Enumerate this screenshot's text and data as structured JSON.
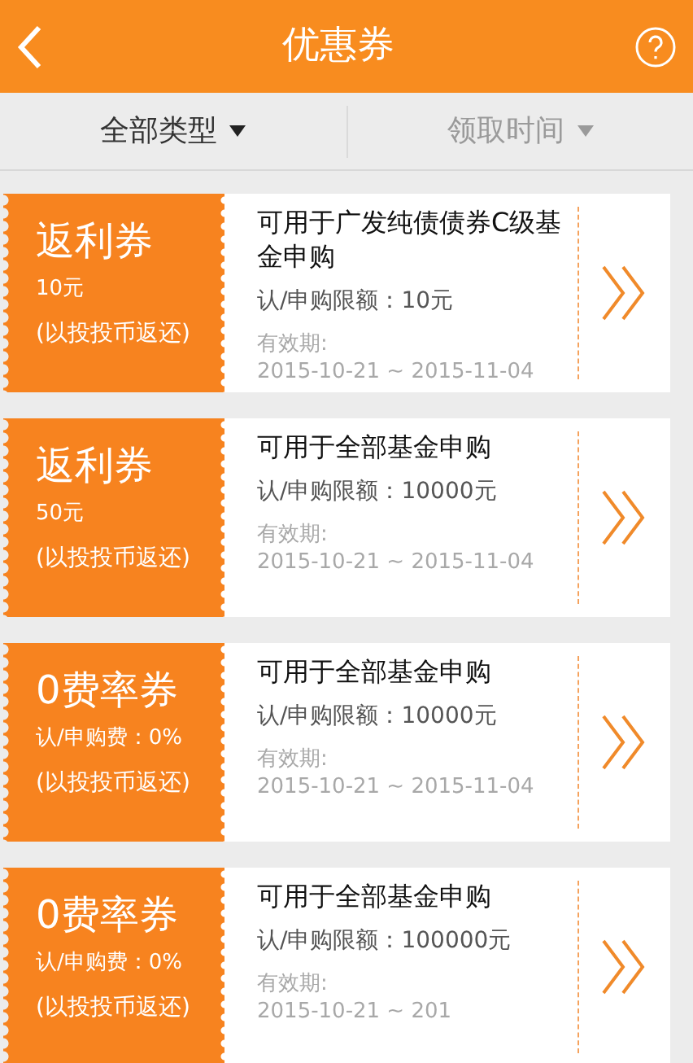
{
  "header": {
    "title": "优惠券"
  },
  "filters": [
    {
      "label": "全部类型",
      "selected": true
    },
    {
      "label": "领取时间",
      "selected": false
    }
  ],
  "coupons": [
    {
      "type_name": "返利券",
      "detail": "10元",
      "note": "(以投投币返还)",
      "title": "可用于广发纯债债券C级基金申购",
      "limit": "认/申购限额：10元",
      "validity_label": "有效期:",
      "validity_dates": "2015-10-21 ~ 2015-11-04"
    },
    {
      "type_name": "返利券",
      "detail": "50元",
      "note": "(以投投币返还)",
      "title": "可用于全部基金申购",
      "limit": "认/申购限额：10000元",
      "validity_label": "有效期:",
      "validity_dates": "2015-10-21 ~ 2015-11-04"
    },
    {
      "type_name": "0费率券",
      "detail": "认/申购费：0%",
      "note": "(以投投币返还)",
      "title": "可用于全部基金申购",
      "limit": "认/申购限额：10000元",
      "validity_label": "有效期:",
      "validity_dates": "2015-10-21 ~ 2015-11-04"
    },
    {
      "type_name": "0费率券",
      "detail": "认/申购费：0%",
      "note": "(以投投币返还)",
      "title": "可用于全部基金申购",
      "limit": "认/申购限额：100000元",
      "validity_label": "有效期:",
      "validity_dates": "2015-10-21 ~ 201"
    }
  ]
}
